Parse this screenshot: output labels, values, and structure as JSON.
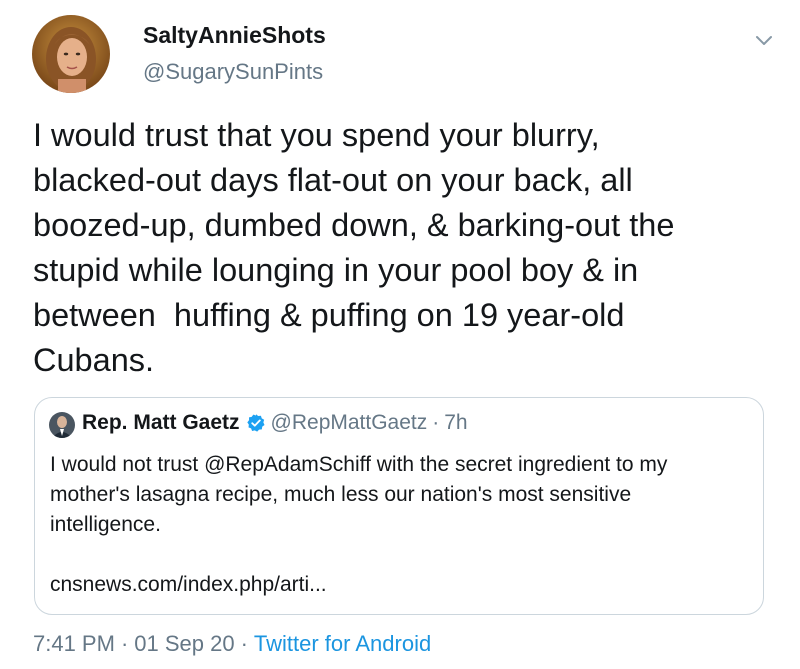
{
  "author": {
    "display_name": "SaltyAnnieShots",
    "handle": "@SugarySunPints",
    "avatar": "avatar-photo"
  },
  "menu_icon": "chevron-down-icon",
  "tweet": {
    "lines": [
      "I would trust that you spend your blurry,",
      "blacked-out days flat-out on your back, all",
      "boozed-up, dumbed down, & barking-out the",
      "stupid while lounging in your pool boy & in",
      "between  huffing & puffing on 19 year-old",
      "Cubans."
    ]
  },
  "quoted": {
    "display_name": "Rep. Matt Gaetz",
    "verified_icon": "verified-badge-icon",
    "handle": "@RepMattGaetz",
    "dot": "·",
    "time": "7h",
    "lines": [
      "I would not trust @RepAdamSchiff with the secret ingredient to my",
      "mother's lasagna recipe, much less our nation's most sensitive",
      "intelligence."
    ],
    "link": "cnsnews.com/index.php/arti..."
  },
  "meta": {
    "time": "7:41 PM",
    "sep1": "·",
    "date": "01 Sep 20",
    "sep2": "·",
    "source": "Twitter for Android"
  },
  "colors": {
    "text": "#14171a",
    "secondary": "#657786",
    "link": "#1b95e0",
    "border": "#ccd6dd",
    "verified": "#1da1f2"
  }
}
